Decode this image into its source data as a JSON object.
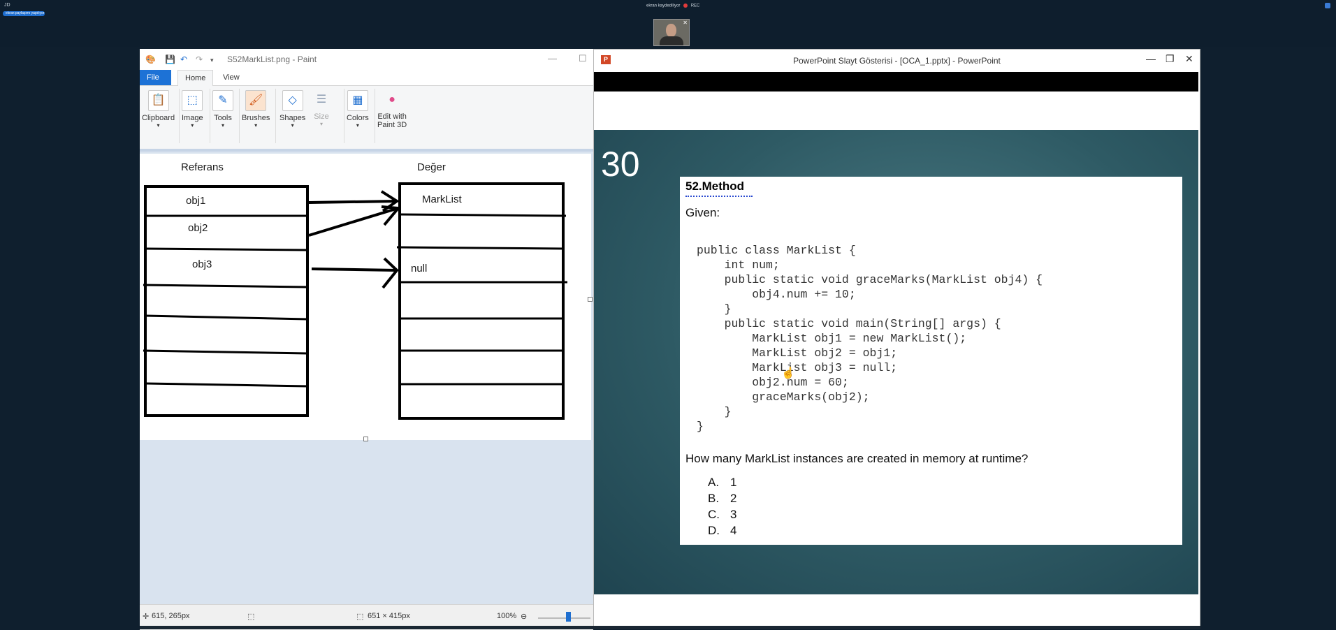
{
  "meeting": {
    "left_text": "JD",
    "pill_text": "ekran paylaşımı yapılıyor",
    "center_text": "ekran kaydediliyor",
    "rec_label": "REC"
  },
  "paint": {
    "title": "S52MarkList.png - Paint",
    "tabs": {
      "file": "File",
      "home": "Home",
      "view": "View"
    },
    "ribbon": {
      "clipboard": "Clipboard",
      "image": "Image",
      "tools": "Tools",
      "brushes": "Brushes",
      "shapes": "Shapes",
      "size": "Size",
      "colors": "Colors",
      "edit3d_line1": "Edit with",
      "edit3d_line2": "Paint 3D"
    },
    "canvas": {
      "ref_header": "Referans",
      "val_header": "Değer",
      "obj1": "obj1",
      "obj2": "obj2",
      "obj3": "obj3",
      "marklist": "MarkList",
      "null": "null"
    },
    "status": {
      "cursor_pos": "615, 265px",
      "image_size": "651 × 415px",
      "zoom": "100%"
    }
  },
  "ppt": {
    "title": "PowerPoint Slayt Gösterisi - [OCA_1.pptx] - PowerPoint",
    "slide_number": "30",
    "question_title": "52.Method",
    "given": "Given:",
    "code_lines": [
      "public class MarkList {",
      "    int num;",
      "    public static void graceMarks(MarkList obj4) {",
      "        obj4.num += 10;",
      "    }",
      "    public static void main(String[] args) {",
      "        MarkList obj1 = new MarkList();",
      "        MarkList obj2 = obj1;",
      "        MarkList obj3 = null;",
      "        obj2.num = 60;",
      "        graceMarks(obj2);",
      "    }",
      "}"
    ],
    "question": "How many MarkList instances are created in memory at runtime?",
    "options": [
      {
        "letter": "A.",
        "text": "1"
      },
      {
        "letter": "B.",
        "text": "2"
      },
      {
        "letter": "C.",
        "text": "3"
      },
      {
        "letter": "D.",
        "text": "4"
      }
    ]
  }
}
